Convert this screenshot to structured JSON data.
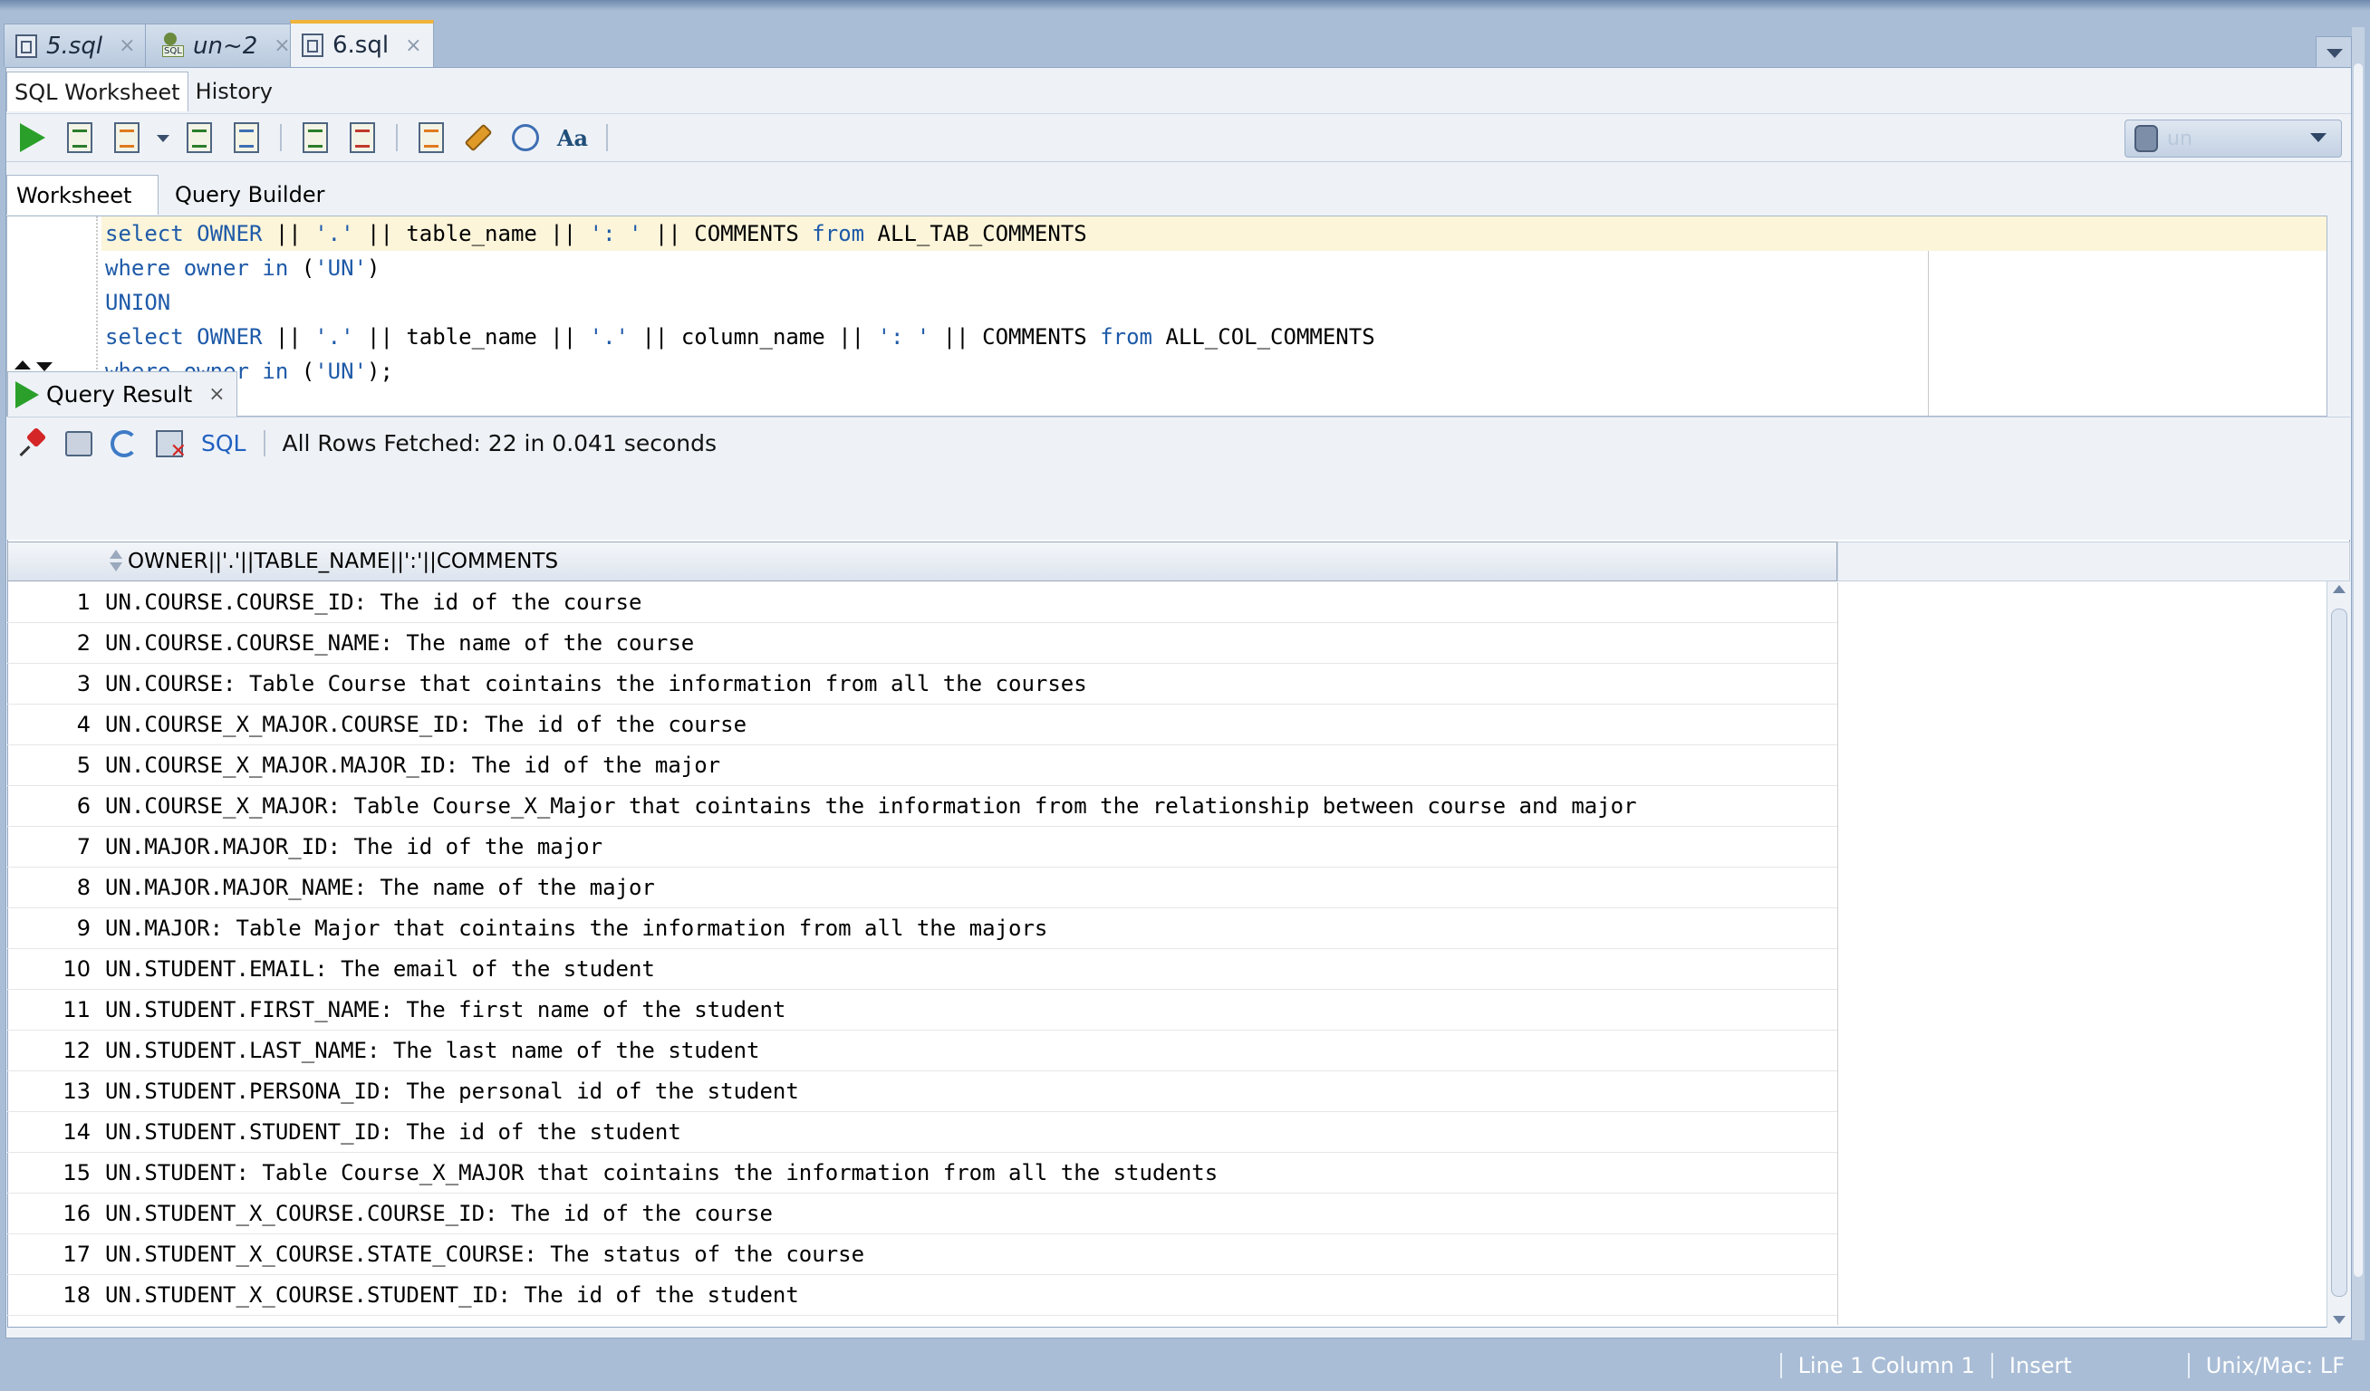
{
  "doc_tabs": [
    {
      "label": "5.sql",
      "icon": "sql-file-icon",
      "active": false
    },
    {
      "label": "un~2",
      "icon": "user-sql-icon",
      "active": false
    },
    {
      "label": "6.sql",
      "icon": "sql-file-icon",
      "active": true
    }
  ],
  "tab_close": "×",
  "subtabs": [
    "SQL Worksheet",
    "History"
  ],
  "toolbar": {
    "icons": [
      "run-statement-icon",
      "run-script-icon",
      "autotrace-icon",
      "explain-plan-icon",
      "sql-tuning-icon",
      "commit-icon",
      "rollback-icon",
      "unshared-sql-icon",
      "clear-icon",
      "history-icon",
      "format-icon"
    ],
    "connection_value": "un"
  },
  "worksheet_tabs": [
    "Worksheet",
    "Query Builder"
  ],
  "editor": {
    "lines": [
      [
        {
          "t": "select",
          "k": "kw"
        },
        {
          "t": " "
        },
        {
          "t": "OWNER",
          "k": "kw"
        },
        {
          "t": " || "
        },
        {
          "t": "'.'",
          "k": "str"
        },
        {
          "t": " || table_name || "
        },
        {
          "t": "': '",
          "k": "str"
        },
        {
          "t": " || COMMENTS "
        },
        {
          "t": "from",
          "k": "kw"
        },
        {
          "t": " ALL_TAB_COMMENTS"
        }
      ],
      [
        {
          "t": "where",
          "k": "kw"
        },
        {
          "t": " "
        },
        {
          "t": "owner",
          "k": "kw"
        },
        {
          "t": " "
        },
        {
          "t": "in",
          "k": "kw"
        },
        {
          "t": " ("
        },
        {
          "t": "'UN'",
          "k": "str"
        },
        {
          "t": ")"
        }
      ],
      [
        {
          "t": "UNION",
          "k": "kw"
        }
      ],
      [
        {
          "t": "select",
          "k": "kw"
        },
        {
          "t": " "
        },
        {
          "t": "OWNER",
          "k": "kw"
        },
        {
          "t": " || "
        },
        {
          "t": "'.'",
          "k": "str"
        },
        {
          "t": " || table_name || "
        },
        {
          "t": "'.'",
          "k": "str"
        },
        {
          "t": " || column_name || "
        },
        {
          "t": "': '",
          "k": "str"
        },
        {
          "t": " || COMMENTS "
        },
        {
          "t": "from",
          "k": "kw"
        },
        {
          "t": " ALL_COL_COMMENTS"
        }
      ],
      [
        {
          "t": "where",
          "k": "kw"
        },
        {
          "t": " "
        },
        {
          "t": "owner",
          "k": "kw"
        },
        {
          "t": " "
        },
        {
          "t": "in",
          "k": "kw"
        },
        {
          "t": " ("
        },
        {
          "t": "'UN'",
          "k": "str"
        },
        {
          "t": ");"
        }
      ]
    ]
  },
  "result": {
    "tab_label": "Query Result",
    "close": "×",
    "sql_link": "SQL",
    "fetch_status": "All Rows Fetched: 22 in 0.041 seconds",
    "column_header": "OWNER||'.'||TABLE_NAME||':'||COMMENTS",
    "rows": [
      {
        "n": "1",
        "v": "UN.COURSE.COURSE_ID: The id of the course"
      },
      {
        "n": "2",
        "v": "UN.COURSE.COURSE_NAME: The name of the course"
      },
      {
        "n": "3",
        "v": "UN.COURSE: Table Course that cointains the information from all the courses"
      },
      {
        "n": "4",
        "v": "UN.COURSE_X_MAJOR.COURSE_ID: The id of the course"
      },
      {
        "n": "5",
        "v": "UN.COURSE_X_MAJOR.MAJOR_ID: The id of the major"
      },
      {
        "n": "6",
        "v": "UN.COURSE_X_MAJOR: Table Course_X_Major that cointains the information from the relationship between course and major"
      },
      {
        "n": "7",
        "v": "UN.MAJOR.MAJOR_ID: The id of the major"
      },
      {
        "n": "8",
        "v": "UN.MAJOR.MAJOR_NAME: The name of the major"
      },
      {
        "n": "9",
        "v": "UN.MAJOR: Table Major that cointains the information from all the majors"
      },
      {
        "n": "10",
        "v": "UN.STUDENT.EMAIL: The email of the student"
      },
      {
        "n": "11",
        "v": "UN.STUDENT.FIRST_NAME: The first name of the student"
      },
      {
        "n": "12",
        "v": "UN.STUDENT.LAST_NAME: The last name of the student"
      },
      {
        "n": "13",
        "v": "UN.STUDENT.PERSONA_ID: The personal id of the student"
      },
      {
        "n": "14",
        "v": "UN.STUDENT.STUDENT_ID: The id of the student"
      },
      {
        "n": "15",
        "v": "UN.STUDENT: Table Course_X_MAJOR that cointains the information from all the students"
      },
      {
        "n": "16",
        "v": "UN.STUDENT_X_COURSE.COURSE_ID: The id of the course"
      },
      {
        "n": "17",
        "v": "UN.STUDENT_X_COURSE.STATE_COURSE: The status of the course"
      },
      {
        "n": "18",
        "v": "UN.STUDENT_X_COURSE.STUDENT_ID: The id of the student"
      }
    ]
  },
  "status_bar": {
    "position": "Line 1 Column 1",
    "mode": "Insert",
    "blank": "",
    "eol": "Unix/Mac: LF"
  },
  "colors": {
    "accent_tab": "#f0b33c",
    "keyword": "#1e5aa8",
    "run_green": "#2aa02a",
    "frame": "#a9bdd6"
  }
}
